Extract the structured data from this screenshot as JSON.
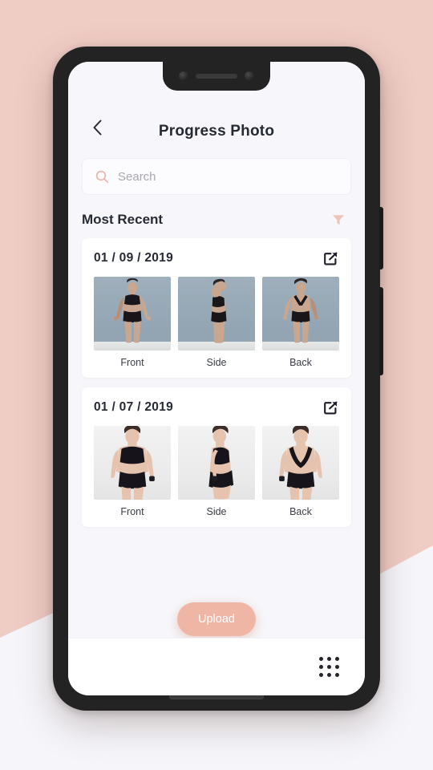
{
  "background": {
    "accent_color": "#EFCCC4",
    "light_color": "#F6F6FA"
  },
  "app": {
    "header": {
      "back_icon": "chevron-left-icon",
      "title": "Progress Photo"
    },
    "search": {
      "icon": "search-icon",
      "placeholder": "Search",
      "value": ""
    },
    "section": {
      "title": "Most Recent",
      "filter_icon": "filter-funnel-icon"
    },
    "cards": [
      {
        "date": "01 / 09 / 2019",
        "share_icon": "share-icon",
        "photos": [
          {
            "label": "Front",
            "style": "bgA",
            "pose": "front"
          },
          {
            "label": "Side",
            "style": "bgA",
            "pose": "side"
          },
          {
            "label": "Back",
            "style": "bgA",
            "pose": "back"
          }
        ]
      },
      {
        "date": "01 / 07 / 2019",
        "share_icon": "share-icon",
        "photos": [
          {
            "label": "Front",
            "style": "bgB",
            "pose": "front2"
          },
          {
            "label": "Side",
            "style": "bgB",
            "pose": "side2"
          },
          {
            "label": "Back",
            "style": "bgB",
            "pose": "back2"
          }
        ]
      }
    ],
    "upload_button": {
      "label": "Upload",
      "color": "#EFB6A6"
    },
    "bottom_bar": {
      "apps_icon": "grid-dots-icon"
    }
  }
}
